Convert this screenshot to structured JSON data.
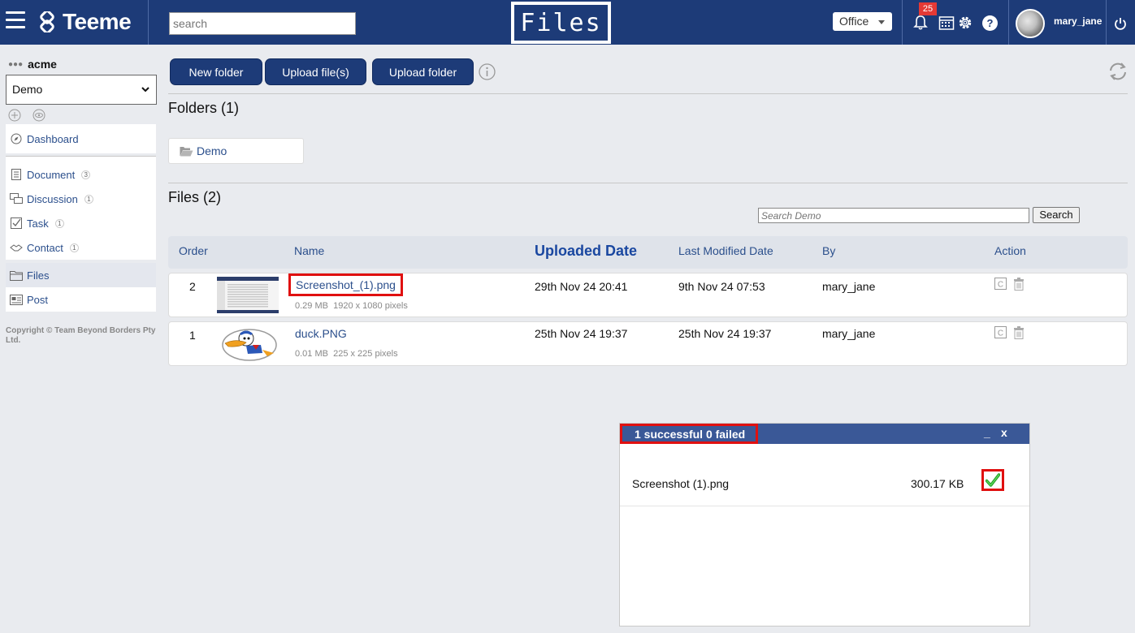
{
  "app": {
    "name": "Teeme",
    "page_title": "Files"
  },
  "topbar": {
    "search_placeholder": "search",
    "office_label": "Office",
    "notification_count": "25",
    "help_label": "?",
    "username": "mary_jane"
  },
  "sidebar": {
    "org": "acme",
    "team_selected": "Demo",
    "items": [
      {
        "label": "Dashboard",
        "icon": "compass-icon"
      },
      {
        "label": "Document",
        "count": "3",
        "icon": "document-icon"
      },
      {
        "label": "Discussion",
        "count": "1",
        "icon": "chat-icon"
      },
      {
        "label": "Task",
        "count": "1",
        "icon": "checkbox-icon"
      },
      {
        "label": "Contact",
        "count": "1",
        "icon": "handshake-icon"
      },
      {
        "label": "Files",
        "icon": "folder-icon"
      },
      {
        "label": "Post",
        "icon": "post-icon"
      }
    ],
    "copyright": "Copyright © Team Beyond Borders Pty Ltd."
  },
  "toolbar": {
    "new_folder": "New folder",
    "upload_files": "Upload file(s)",
    "upload_folder": "Upload folder"
  },
  "folders": {
    "title": "Folders (1)",
    "items": [
      {
        "name": "Demo"
      }
    ]
  },
  "files": {
    "title": "Files (2)",
    "search_placeholder": "Search Demo",
    "search_button": "Search",
    "columns": {
      "order": "Order",
      "name": "Name",
      "uploaded": "Uploaded Date",
      "modified": "Last Modified Date",
      "by": "By",
      "action": "Action"
    },
    "rows": [
      {
        "order": "2",
        "name": "Screenshot_(1).png",
        "size": "0.29 MB",
        "dims": "1920 x 1080 pixels",
        "uploaded": "29th Nov 24 20:41",
        "modified": "9th Nov 24 07:53",
        "by": "mary_jane"
      },
      {
        "order": "1",
        "name": "duck.PNG",
        "size": "0.01 MB",
        "dims": "225 x 225 pixels",
        "uploaded": "25th Nov 24 19:37",
        "modified": "25th Nov 24 19:37",
        "by": "mary_jane"
      }
    ],
    "copy_label": "C"
  },
  "upload_panel": {
    "title": "1 successful 0 failed",
    "minimize": "_",
    "close": "x",
    "items": [
      {
        "name": "Screenshot (1).png",
        "size": "300.17 KB"
      }
    ]
  },
  "colors": {
    "brand": "#1d3b78",
    "link": "#2b4f8c",
    "highlight": "#e01010",
    "success": "#22a822"
  }
}
